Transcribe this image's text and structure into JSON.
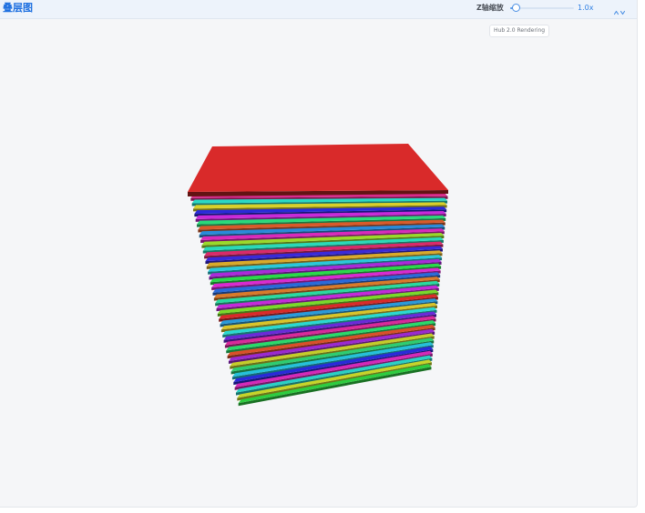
{
  "header": {
    "title": "叠层图",
    "z_scale_label": "Z轴缩放",
    "z_scale_value": "1.0x",
    "z_scale_fraction": 0.1,
    "reset_icon": "reset-view-icon"
  },
  "badge": {
    "text": "Hub 2.0 Rendering"
  },
  "stack": {
    "top_layer_color": "#d92a2a",
    "layer_colors": [
      "#2ecc40",
      "#c6d42a",
      "#2ad0c4",
      "#d42ab8",
      "#2a2ad9",
      "#25c0d9",
      "#2ecc71",
      "#c4cc2a",
      "#9a2ad0",
      "#d9502a",
      "#2ad96a",
      "#d92a9a",
      "#6a2ad9",
      "#2ad9d0",
      "#d9c42a",
      "#2a9ad9",
      "#d92a2a",
      "#7ad92a",
      "#c42ad9",
      "#2ad9a0",
      "#d97a2a",
      "#2a6ad9",
      "#d92ad0",
      "#2ad94a",
      "#aa2ad9",
      "#2ac8d9",
      "#d9aa2a",
      "#3a2ad9",
      "#d92a6a",
      "#2ad9b8",
      "#9ad92a",
      "#d92aba",
      "#2a8ad9",
      "#d95a2a",
      "#2ad97a",
      "#c82ad9",
      "#2a2ad9",
      "#d9d02a",
      "#2ad9c4",
      "#d92a8a"
    ]
  }
}
